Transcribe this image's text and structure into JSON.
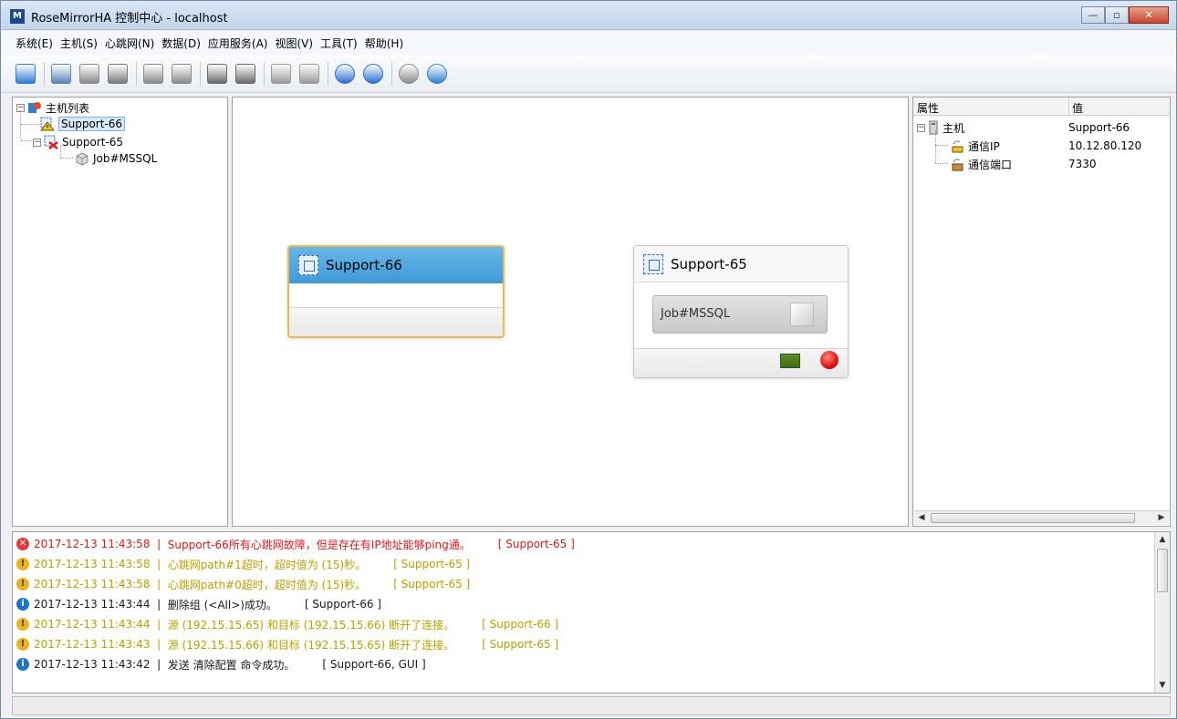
{
  "window": {
    "title": "RoseMirrorHA 控制中心  -  localhost",
    "logo": "M",
    "controls": {
      "minimize": "—",
      "maximize": "▫",
      "close": "✕"
    }
  },
  "menu": [
    "系统(E)",
    "主机(S)",
    "心跳网(N)",
    "数据(D)",
    "应用服务(A)",
    "视图(V)",
    "工具(T)",
    "帮助(H)"
  ],
  "toolbar": [
    {
      "icon": "key-icon",
      "color": "#2f7fd1"
    },
    {
      "icon": "host-screen-icon",
      "color": "#5a86b5"
    },
    {
      "icon": "box-icon",
      "color": "#8a8a8a"
    },
    {
      "icon": "gear-box-icon",
      "color": "#7a7a7a"
    },
    {
      "icon": "box-add-icon",
      "color": "#8a8a8a"
    },
    {
      "icon": "box-remove-icon",
      "color": "#8a8a8a"
    },
    {
      "icon": "monitor-icon",
      "color": "#6a6a6a"
    },
    {
      "icon": "monitor-arrow-icon",
      "color": "#6a6a6a"
    },
    {
      "icon": "export-icon",
      "color": "#9a9a9a"
    },
    {
      "icon": "import-icon",
      "color": "#9a9a9a"
    },
    {
      "icon": "network-icon",
      "color": "#2e6fd0"
    },
    {
      "icon": "network-clock-icon",
      "color": "#2e6fd0"
    },
    {
      "icon": "refresh-icon",
      "color": "#8c8c8c"
    },
    {
      "icon": "help-icon",
      "color": "#2f7fd1"
    }
  ],
  "tree": {
    "root": "主机列表",
    "hosts": [
      {
        "name": "Support-66",
        "status": "warning",
        "selected": true
      },
      {
        "name": "Support-65",
        "status": "error",
        "selected": false,
        "children": [
          "Job#MSSQL"
        ]
      }
    ]
  },
  "canvas": {
    "nodes": [
      {
        "name": "Support-66",
        "selected": true
      },
      {
        "name": "Support-65",
        "selected": false,
        "job": "Job#MSSQL"
      }
    ]
  },
  "properties": {
    "headers": {
      "attr": "属性",
      "value": "值"
    },
    "rows": [
      {
        "label": "主机",
        "value": "Support-66"
      },
      {
        "label": "通信IP",
        "value": "10.12.80.120"
      },
      {
        "label": "通信端口",
        "value": "7330"
      }
    ]
  },
  "log": [
    {
      "level": "error",
      "time": "2017-12-13 11:43:58",
      "msg": "Support-66所有心跳网故障，但是存在有IP地址能够ping通。",
      "src": "[ Support-65 ]"
    },
    {
      "level": "warn",
      "time": "2017-12-13 11:43:58",
      "msg": "心跳网path#1超时，超时值为 (15)秒。",
      "src": "[ Support-65 ]"
    },
    {
      "level": "warn",
      "time": "2017-12-13 11:43:58",
      "msg": "心跳网path#0超时，超时值为 (15)秒。",
      "src": "[ Support-65 ]"
    },
    {
      "level": "info",
      "time": "2017-12-13 11:43:44",
      "msg": "删除组 (<All>)成功。",
      "src": "[ Support-66 ]"
    },
    {
      "level": "warn",
      "time": "2017-12-13 11:43:44",
      "msg": "源 (192.15.15.65) 和目标 (192.15.15.66) 断开了连接。",
      "src": "[ Support-66 ]"
    },
    {
      "level": "warn",
      "time": "2017-12-13 11:43:43",
      "msg": "源 (192.15.15.66) 和目标 (192.15.15.65) 断开了连接。",
      "src": "[ Support-65 ]"
    },
    {
      "level": "info",
      "time": "2017-12-13 11:43:42",
      "msg": "发送 清除配置 命令成功。",
      "src": "[ Support-66, GUI ]"
    }
  ],
  "colors": {
    "error": "#e01818",
    "warn": "#b8a000",
    "info": "#1a1a1a",
    "accent": "#3f9ad6",
    "selection": "#f0b450"
  }
}
